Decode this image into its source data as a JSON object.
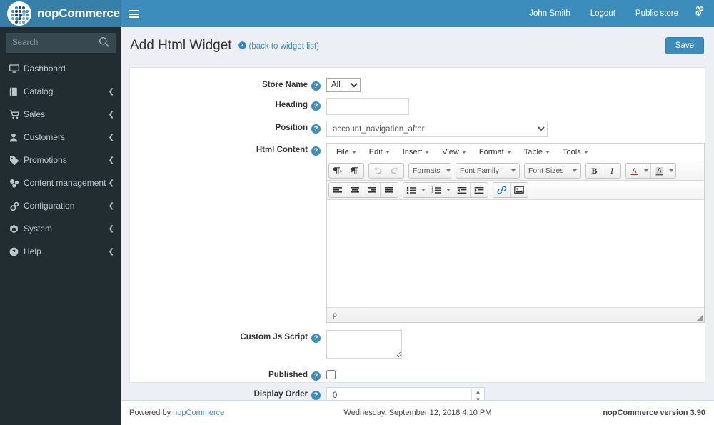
{
  "brand": {
    "name": "nopCommerce",
    "logo_icon": "nop-dots-logo"
  },
  "topnav": {
    "menu_toggle_icon": "hamburger-icon",
    "user": "John Smith",
    "logout": "Logout",
    "public_store": "Public store",
    "settings_icon": "gears-icon"
  },
  "sidebar": {
    "search_placeholder": "Search",
    "search_icon": "search-icon",
    "items": [
      {
        "label": "Dashboard",
        "icon": "dashboard-monitor-icon",
        "caret": false
      },
      {
        "label": "Catalog",
        "icon": "catalog-book-icon",
        "caret": true
      },
      {
        "label": "Sales",
        "icon": "sales-cart-icon",
        "caret": true
      },
      {
        "label": "Customers",
        "icon": "customers-user-icon",
        "caret": true
      },
      {
        "label": "Promotions",
        "icon": "promotions-tag-icon",
        "caret": true
      },
      {
        "label": "Content management",
        "icon": "content-cubes-icon",
        "caret": true
      },
      {
        "label": "Configuration",
        "icon": "configuration-gears-icon",
        "caret": true
      },
      {
        "label": "System",
        "icon": "system-cube-icon",
        "caret": true
      },
      {
        "label": "Help",
        "icon": "help-question-icon",
        "caret": true
      }
    ],
    "caret_icon": "chevron-left-icon"
  },
  "page": {
    "title": "Add Html Widget",
    "back_link": "(back to widget list)",
    "back_icon": "arrow-circle-left-icon",
    "save_label": "Save",
    "accent_color": "#3c8dbc"
  },
  "form": {
    "store_name": {
      "label": "Store Name",
      "help_icon": "question-circle-icon",
      "value": "All",
      "options": [
        "All"
      ]
    },
    "heading": {
      "label": "Heading",
      "help_icon": "question-circle-icon",
      "value": "",
      "placeholder": ""
    },
    "position": {
      "label": "Position",
      "help_icon": "question-circle-icon",
      "value": "account_navigation_after",
      "options": [
        "account_navigation_after"
      ]
    },
    "html_content": {
      "label": "Html Content",
      "help_icon": "question-circle-icon",
      "value": "",
      "status_path": "p"
    },
    "custom_js": {
      "label": "Custom Js Script",
      "help_icon": "question-circle-icon",
      "value": ""
    },
    "published": {
      "label": "Published",
      "help_icon": "question-circle-icon",
      "checked": false
    },
    "display_order": {
      "label": "Display Order",
      "help_icon": "question-circle-icon",
      "value": "0"
    }
  },
  "editor": {
    "menubar": [
      {
        "label": "File",
        "icon": "chevron-down-icon"
      },
      {
        "label": "Edit",
        "icon": "chevron-down-icon"
      },
      {
        "label": "Insert",
        "icon": "chevron-down-icon"
      },
      {
        "label": "View",
        "icon": "chevron-down-icon"
      },
      {
        "label": "Format",
        "icon": "chevron-down-icon"
      },
      {
        "label": "Table",
        "icon": "chevron-down-icon"
      },
      {
        "label": "Tools",
        "icon": "chevron-down-icon"
      }
    ],
    "toolbar_row1": {
      "ltr_icon": "ltr-paragraph-icon",
      "rtl_icon": "rtl-paragraph-icon",
      "undo_icon": "undo-arrow-icon",
      "redo_icon": "redo-arrow-icon",
      "formats_label": "Formats",
      "font_family_label": "Font Family",
      "font_sizes_label": "Font Sizes",
      "bold_label": "B",
      "italic_label": "I",
      "forecolor_icon": "text-color-icon",
      "backcolor_icon": "background-color-icon"
    },
    "toolbar_row2": {
      "align_left_icon": "align-left-icon",
      "align_center_icon": "align-center-icon",
      "align_right_icon": "align-right-icon",
      "align_justify_icon": "align-justify-icon",
      "bullist_icon": "unordered-list-icon",
      "numlist_icon": "ordered-list-icon",
      "outdent_icon": "outdent-icon",
      "indent_icon": "indent-icon",
      "link_icon": "link-chain-icon",
      "image_icon": "image-picture-icon"
    },
    "resize_icon": "resize-handle-icon"
  },
  "footer": {
    "powered_by_prefix": "Powered by ",
    "powered_by_link": "nopCommerce",
    "datetime": "Wednesday, September 12, 2018 4:10 PM",
    "version": "nopCommerce version 3.90"
  }
}
